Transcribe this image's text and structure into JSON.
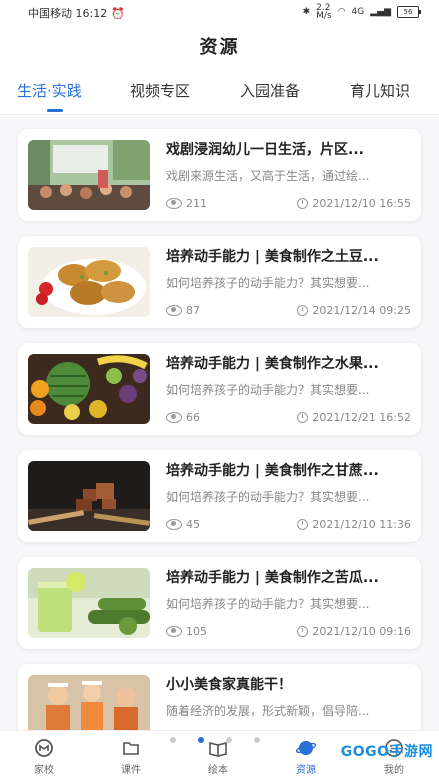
{
  "status_bar": {
    "carrier_time": "中国移动 16:12",
    "net_speed": "2.2\nM/s",
    "signal": "4G",
    "battery": "56"
  },
  "header": {
    "title": "资源"
  },
  "tabs": [
    {
      "label": "生活·实践",
      "active": true
    },
    {
      "label": "视频专区",
      "active": false
    },
    {
      "label": "入园准备",
      "active": false
    },
    {
      "label": "育儿知识",
      "active": false
    }
  ],
  "articles": [
    {
      "title": "戏剧浸润幼儿一日生活，片区...",
      "desc": "戏剧来源生活，又高于生活，通过绘...",
      "views": "211",
      "date": "2021/12/10 16:55",
      "thumb": "classroom-photo"
    },
    {
      "title": "培养动手能力 | 美食制作之土豆...",
      "desc": "如何培养孩子的动手能力？其实想要...",
      "views": "87",
      "date": "2021/12/14 09:25",
      "thumb": "potato-pancake-photo"
    },
    {
      "title": "培养动手能力 | 美食制作之水果...",
      "desc": "如何培养孩子的动手能力？其实想要...",
      "views": "66",
      "date": "2021/12/21 16:52",
      "thumb": "fruit-photo"
    },
    {
      "title": "培养动手能力 | 美食制作之甘蔗...",
      "desc": "如何培养孩子的动手能力？其实想要...",
      "views": "45",
      "date": "2021/12/10 11:36",
      "thumb": "sugarcane-photo"
    },
    {
      "title": "培养动手能力 | 美食制作之苦瓜...",
      "desc": "如何培养孩子的动手能力？其实想要...",
      "views": "105",
      "date": "2021/12/10 09:16",
      "thumb": "bitter-melon-juice-photo"
    },
    {
      "title": "小小美食家真能干！",
      "desc": "随着经济的发展，形式新颖，倡导陪...",
      "views": "",
      "date": "",
      "thumb": "kids-cooking-photo"
    }
  ],
  "tabbar": {
    "items": [
      {
        "label": "家校",
        "icon": "school-icon"
      },
      {
        "label": "课件",
        "icon": "folder-icon"
      },
      {
        "label": "绘本",
        "icon": "book-icon"
      },
      {
        "label": "资源",
        "icon": "planet-icon"
      },
      {
        "label": "我的",
        "icon": "smiley-icon"
      }
    ],
    "watermark": "GOGO手游网"
  },
  "colors": {
    "accent": "#2a6fd8"
  }
}
